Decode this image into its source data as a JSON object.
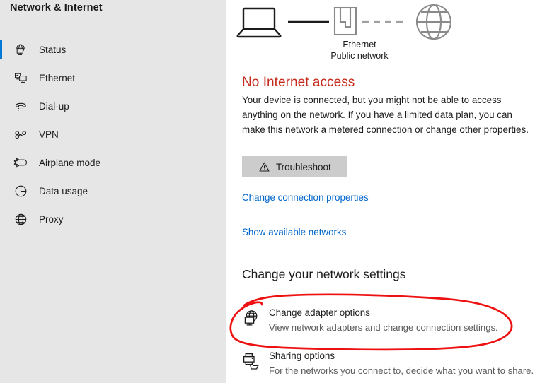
{
  "sidebar": {
    "title": "Network & Internet",
    "items": [
      {
        "label": "Status",
        "icon": "globe-monitor-icon",
        "selected": true
      },
      {
        "label": "Ethernet",
        "icon": "ethernet-monitor-icon",
        "selected": false
      },
      {
        "label": "Dial-up",
        "icon": "dialup-phone-icon",
        "selected": false
      },
      {
        "label": "VPN",
        "icon": "vpn-key-icon",
        "selected": false
      },
      {
        "label": "Airplane mode",
        "icon": "airplane-icon",
        "selected": false
      },
      {
        "label": "Data usage",
        "icon": "pie-chart-icon",
        "selected": false
      },
      {
        "label": "Proxy",
        "icon": "globe-icon",
        "selected": false
      }
    ]
  },
  "main": {
    "diagram": {
      "device_icon": "laptop-icon",
      "network_icon": "ethernet-port-icon",
      "internet_icon": "globe-icon",
      "network_name": "Ethernet",
      "network_type": "Public network",
      "device_link_style": "solid",
      "internet_link_style": "dashed"
    },
    "status": {
      "title": "No Internet access",
      "title_color": "#c42b1c",
      "description": "Your device is connected, but you might not be able to access anything on the network. If you have a limited data plan, you can make this network a metered connection or change other properties."
    },
    "troubleshoot_button": {
      "label": "Troubleshoot",
      "icon": "warning-triangle-icon"
    },
    "links": [
      {
        "label": "Change connection properties"
      },
      {
        "label": "Show available networks"
      }
    ],
    "link_color": "#0066cc",
    "section": {
      "heading": "Change your network settings",
      "rows": [
        {
          "icon": "globe-monitor-icon",
          "title": "Change adapter options",
          "subtitle": "View network adapters and change connection settings."
        },
        {
          "icon": "printer-share-icon",
          "title": "Sharing options",
          "subtitle": "For the networks you connect to, decide what you want to share."
        }
      ]
    }
  },
  "annotation": {
    "shape": "hand-drawn-ellipse",
    "color": "#ee1111",
    "target": "Change adapter options"
  }
}
